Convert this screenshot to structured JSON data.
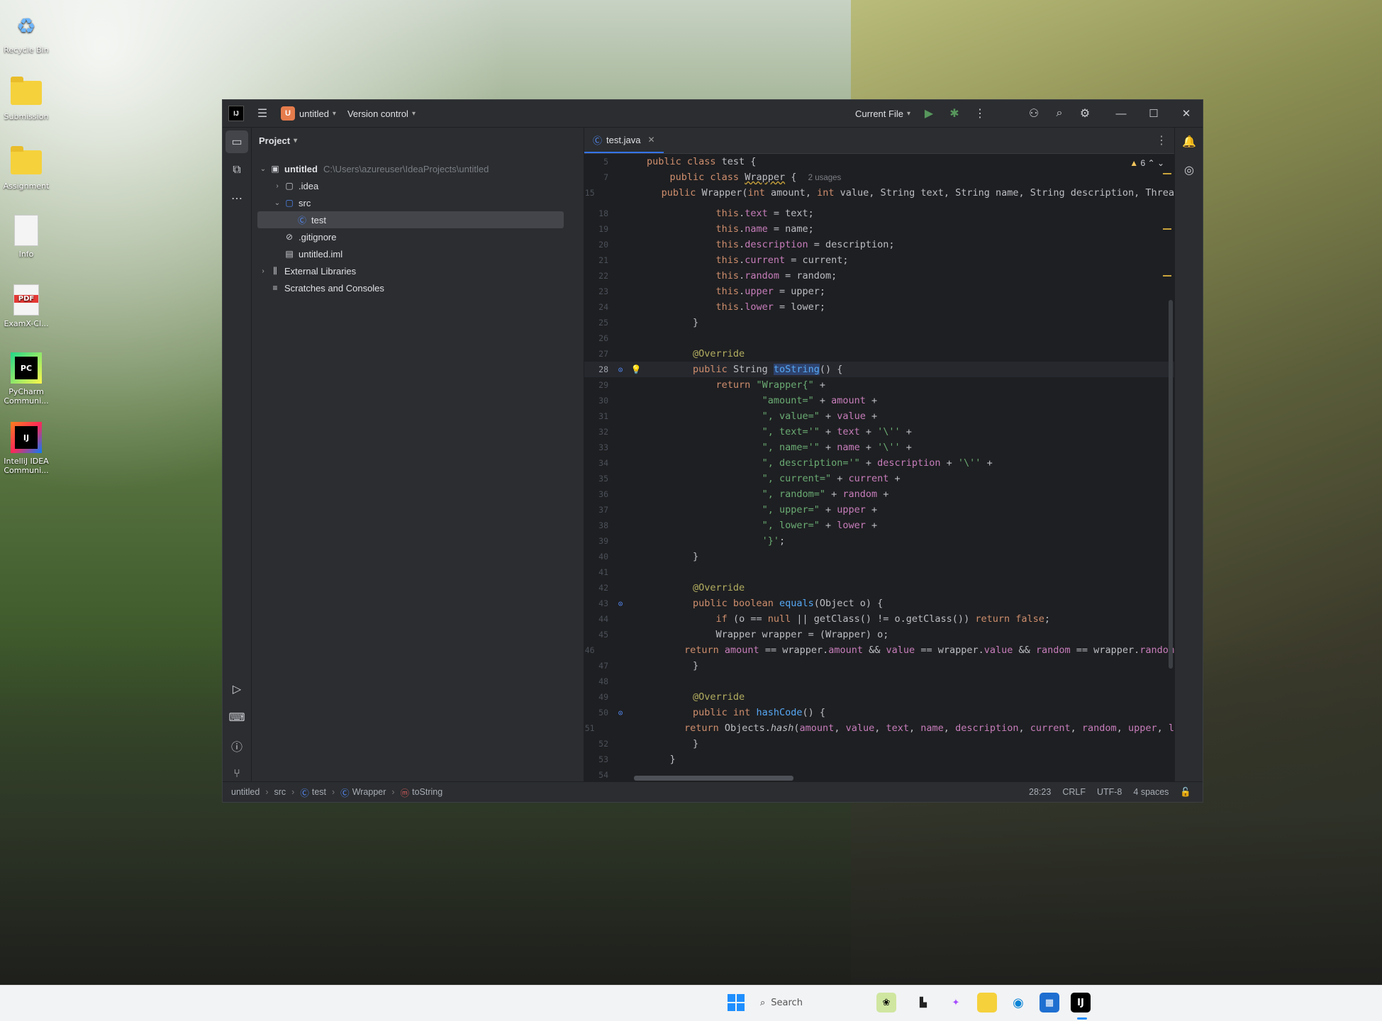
{
  "desktop": {
    "icons": [
      {
        "label": "Recycle Bin",
        "icon": "recycle-bin-icon"
      },
      {
        "label": "Submission",
        "icon": "folder-icon"
      },
      {
        "label": "Assignment",
        "icon": "folder-icon"
      },
      {
        "label": "Info",
        "icon": "document-icon"
      },
      {
        "label": "ExamX-Cl...",
        "icon": "pdf-icon"
      },
      {
        "label": "PyCharm Communi...",
        "icon": "pycharm-icon"
      },
      {
        "label": "IntelliJ IDEA Communi...",
        "icon": "intellij-icon"
      }
    ]
  },
  "titlebar": {
    "project_badge": "U",
    "project_name": "untitled",
    "vcs_label": "Version control",
    "run_config": "Current File"
  },
  "project_pane": {
    "header": "Project",
    "tree": [
      {
        "label": "untitled",
        "path": "C:\\Users\\azureuser\\IdeaProjects\\untitled"
      },
      {
        "label": ".idea"
      },
      {
        "label": "src"
      },
      {
        "label": "test"
      },
      {
        "label": ".gitignore"
      },
      {
        "label": "untitled.iml"
      },
      {
        "label": "External Libraries"
      },
      {
        "label": "Scratches and Consoles"
      }
    ]
  },
  "editor": {
    "tab_label": "test.java",
    "warning_count": "6",
    "usages_hint": "2 usages",
    "line_numbers": [
      "5",
      "7",
      "15",
      "18",
      "19",
      "20",
      "21",
      "22",
      "23",
      "24",
      "25",
      "26",
      "27",
      "28",
      "29",
      "30",
      "31",
      "32",
      "33",
      "34",
      "35",
      "36",
      "37",
      "38",
      "39",
      "40",
      "41",
      "42",
      "43",
      "44",
      "45",
      "46",
      "47",
      "48",
      "49",
      "50",
      "51",
      "52",
      "53",
      "54"
    ]
  },
  "statusbar": {
    "crumbs": [
      "untitled",
      "src",
      "test",
      "Wrapper",
      "toString"
    ],
    "position": "28:23",
    "line_ending": "CRLF",
    "encoding": "UTF-8",
    "indent": "4 spaces"
  },
  "taskbar": {
    "search_placeholder": "Search",
    "ij_badge": "IJ"
  },
  "colors": {
    "accent": "#3574f0",
    "keyword": "#cf8e6d",
    "string": "#6aab73",
    "field": "#c77dbb",
    "annotation": "#b3ae60"
  }
}
